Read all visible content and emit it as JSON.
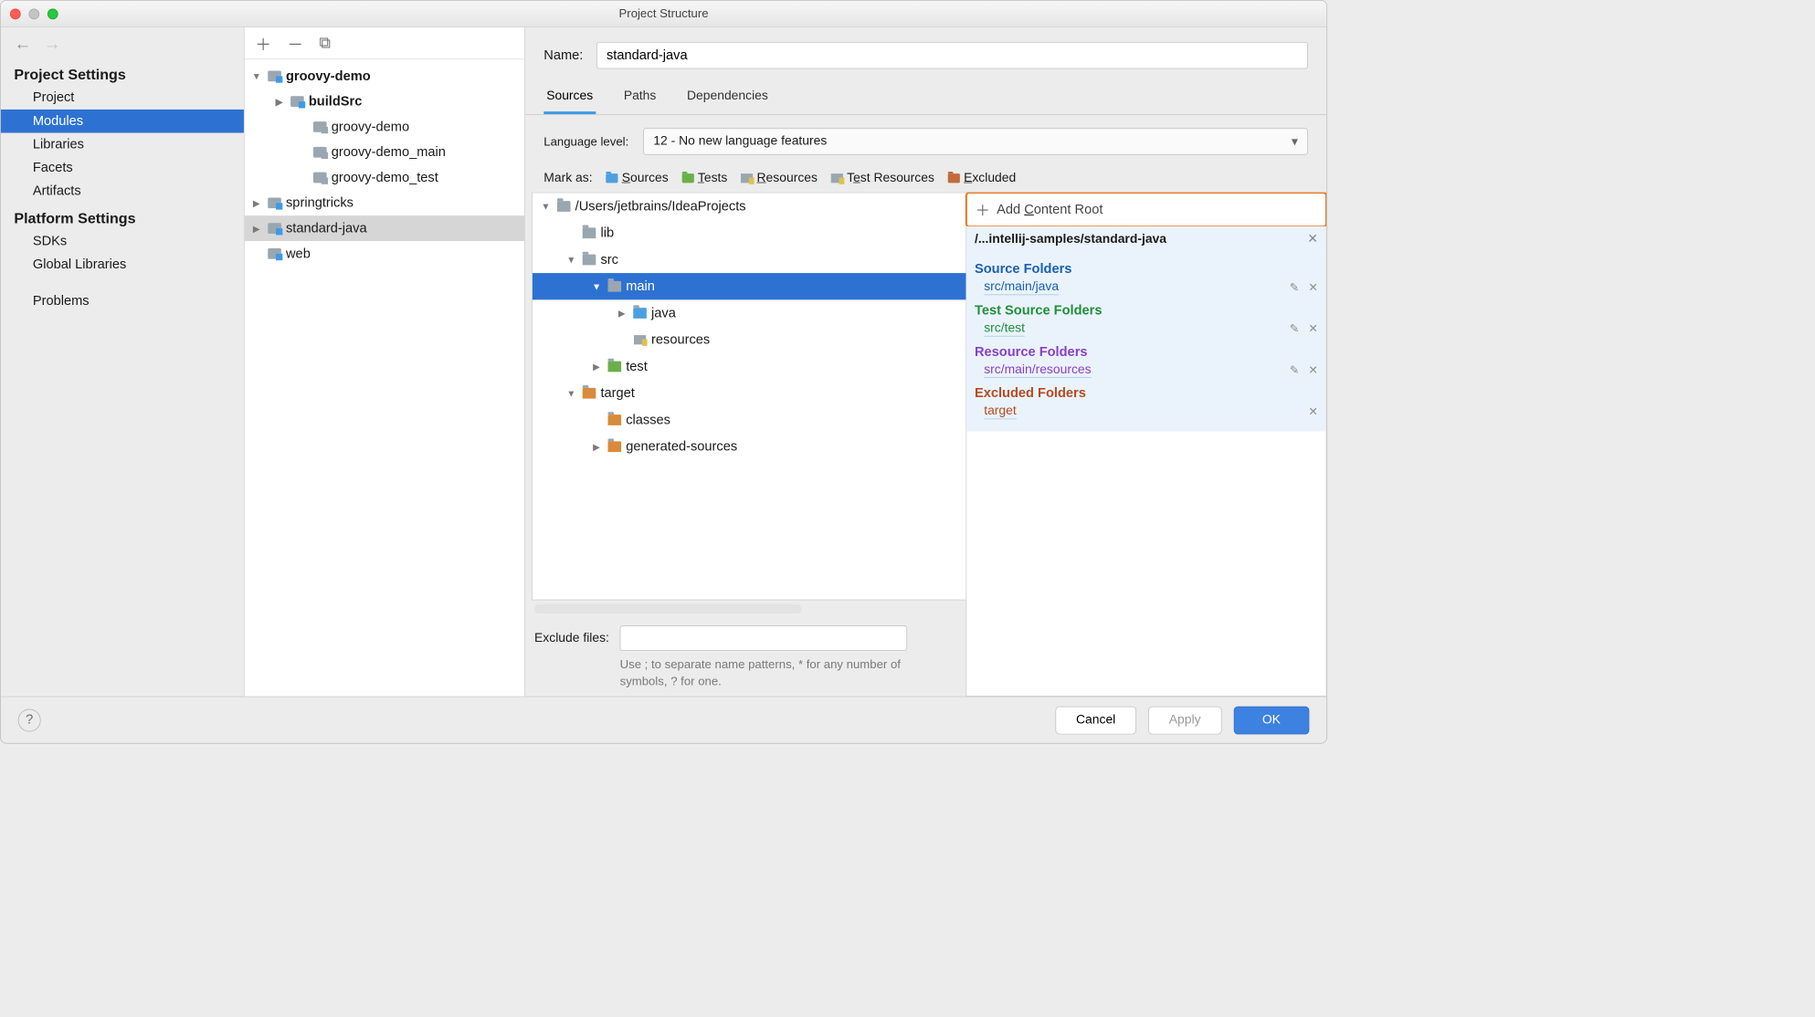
{
  "window": {
    "title": "Project Structure"
  },
  "leftnav": {
    "section1": "Project Settings",
    "items1": [
      "Project",
      "Modules",
      "Libraries",
      "Facets",
      "Artifacts"
    ],
    "selected1": "Modules",
    "section2": "Platform Settings",
    "items2": [
      "SDKs",
      "Global Libraries"
    ],
    "bottom": "Problems"
  },
  "modules": {
    "tree": [
      {
        "label": "groovy-demo",
        "depth": 0,
        "bold": true,
        "arrow": "down",
        "icon": "mod"
      },
      {
        "label": "buildSrc",
        "depth": 1,
        "bold": true,
        "arrow": "right",
        "icon": "mod"
      },
      {
        "label": "groovy-demo",
        "depth": 2,
        "icon": "modg"
      },
      {
        "label": "groovy-demo_main",
        "depth": 2,
        "icon": "modg"
      },
      {
        "label": "groovy-demo_test",
        "depth": 2,
        "icon": "modg"
      },
      {
        "label": "springtricks",
        "depth": 0,
        "arrow": "right",
        "icon": "mod"
      },
      {
        "label": "standard-java",
        "depth": 0,
        "arrow": "right",
        "icon": "mod",
        "selected": true
      },
      {
        "label": "web",
        "depth": 0,
        "icon": "mod"
      }
    ]
  },
  "right": {
    "name_label": "Name:",
    "name_value": "standard-java",
    "tabs": [
      "Sources",
      "Paths",
      "Dependencies"
    ],
    "active_tab": "Sources",
    "langlevel_label": "Language level:",
    "langlevel_value": "12 - No new language features",
    "markas_label": "Mark as:",
    "marks": [
      {
        "label": "Sources",
        "color": "#4da0e0",
        "u": "S"
      },
      {
        "label": "Tests",
        "color": "#6ab04a",
        "u": "T"
      },
      {
        "label": "Resources",
        "color": "#9aa7b0",
        "u": "R",
        "res": true
      },
      {
        "label": "Test Resources",
        "color": "#9aa7b0",
        "u": "",
        "res": true,
        "multi": true
      },
      {
        "label": "Excluded",
        "color": "#c46a3a",
        "u": "E"
      }
    ],
    "src_tree": [
      {
        "label": "/Users/jetbrains/IdeaProjects",
        "depth": 0,
        "arrow": "down",
        "col": "grey"
      },
      {
        "label": "lib",
        "depth": 1,
        "col": "grey"
      },
      {
        "label": "src",
        "depth": 1,
        "arrow": "down",
        "col": "grey"
      },
      {
        "label": "main",
        "depth": 2,
        "arrow": "down",
        "col": "grey",
        "sel": true
      },
      {
        "label": "java",
        "depth": 3,
        "arrow": "right",
        "col": "blue"
      },
      {
        "label": "resources",
        "depth": 3,
        "col": "grey",
        "res": true
      },
      {
        "label": "test",
        "depth": 2,
        "arrow": "right",
        "col": "green"
      },
      {
        "label": "target",
        "depth": 1,
        "arrow": "down",
        "col": "orange"
      },
      {
        "label": "classes",
        "depth": 2,
        "col": "orange"
      },
      {
        "label": "generated-sources",
        "depth": 2,
        "arrow": "right",
        "col": "orange"
      }
    ],
    "add_cr": "Add Content Root",
    "cr_path": "/...intellij-samples/standard-java",
    "groups": [
      {
        "title": "Source Folders",
        "cls": "blue",
        "items": [
          "src/main/java"
        ]
      },
      {
        "title": "Test Source Folders",
        "cls": "green",
        "items": [
          "src/test"
        ]
      },
      {
        "title": "Resource Folders",
        "cls": "purple",
        "items": [
          "src/main/resources"
        ]
      },
      {
        "title": "Excluded Folders",
        "cls": "redb",
        "items": [
          "target"
        ]
      }
    ],
    "exclude_label": "Exclude files:",
    "exclude_hint": "Use ; to separate name patterns, * for any number of symbols, ? for one."
  },
  "buttons": {
    "cancel": "Cancel",
    "apply": "Apply",
    "ok": "OK"
  }
}
